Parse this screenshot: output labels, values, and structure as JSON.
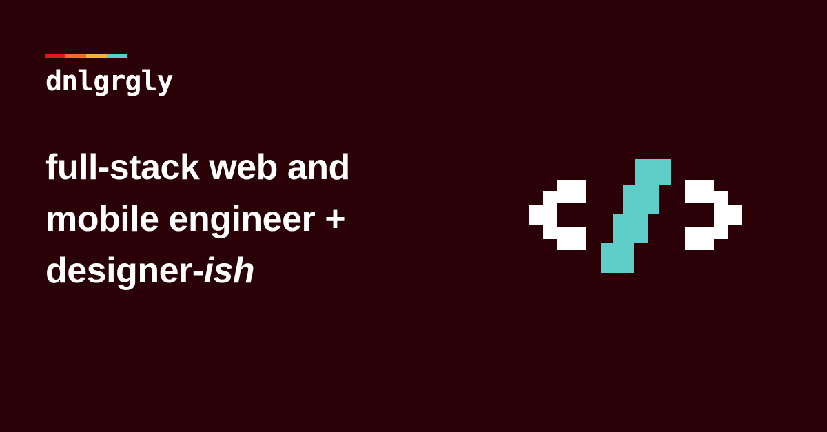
{
  "brand": {
    "name": "dnlgrgly",
    "stripe_colors": [
      "#e0181f",
      "#ec6b2a",
      "#f2b33a",
      "#5ecdc8"
    ]
  },
  "headline": {
    "line1": "full-stack web and",
    "line2": "mobile engineer +",
    "line3_main": "designer-",
    "line3_emphasis": "ish"
  },
  "icon": {
    "name": "code-brackets-icon",
    "bracket_color": "#ffffff",
    "slash_color": "#5ecdc8"
  },
  "colors": {
    "background": "#2a0106",
    "text": "#ffffff"
  }
}
